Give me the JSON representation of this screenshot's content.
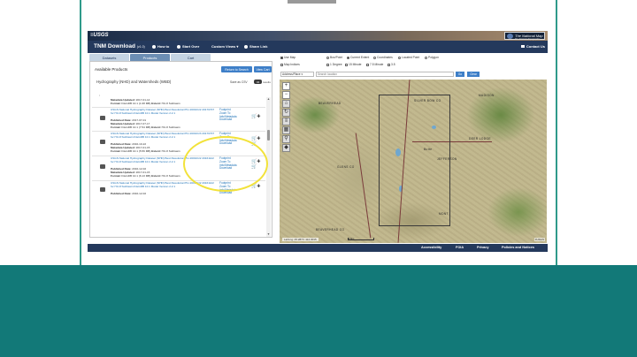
{
  "brand": {
    "usgs": "≡USGS",
    "tnm_title": "The National Map",
    "tnm_sub": "The Nation's Topographic Map"
  },
  "header": {
    "title": "TNM Download",
    "version": "(v1.0)",
    "nav": [
      "How to",
      "Start Over",
      "Custom Views ▾",
      "Share Link"
    ],
    "contact": "Contact Us"
  },
  "tabs": [
    "Datasets",
    "Products",
    "Cart"
  ],
  "products": {
    "title": "Available Products",
    "return_button": "Return to Search",
    "cart_button": "View Cart",
    "heading": "Hydrography (NHD) and Watersheds (WBD)",
    "save_csv": "Save as CSV",
    "results_count": "34",
    "results_word": "results",
    "ellipsis": ":",
    "items": [
      {
        "meta": [
          [
            "Metadata Updated:",
            "2017-01-14"
          ],
          [
            "Format:",
            "FileGDB 10.1 (1.08 MB)"
          ],
          [
            "Extent:",
            "HU-8 Subbasin"
          ]
        ],
        "title": "",
        "links": [],
        "cart": false
      },
      {
        "title": "USGS National Hydrography Dataset (NHD) Best Resolution/HU-160101/2 20170707 for HU-8 Subbasin FileGDB 10.1 Model Version 2.2.1",
        "meta": [
          [
            "Published Date:",
            "2017-07-01"
          ],
          [
            "Metadata Updated:",
            "2017-07-17"
          ],
          [
            "Format:",
            "FileGDB 10.1 (7.54 MB)"
          ],
          [
            "Extent:",
            "HU-8 Subbasin"
          ]
        ],
        "links": [
          "Footprint",
          "Zoom To",
          "Info/Metadata",
          "Download"
        ],
        "cart": true
      },
      {
        "title": "USGS National Hydrography Dataset (NHD) Best Resolution/HU-160101/3 20170707 for HU-8 Subbasin FileGDB 10.1 Model Version 2.2.1",
        "meta": [
          [
            "Published Date:",
            "2016-10-22"
          ],
          [
            "Metadata Updated:",
            "2017-01-15"
          ],
          [
            "Format:",
            "FileGDB 10.1 (5.56 MB)"
          ],
          [
            "Extent:",
            "HU-8 Subbasin"
          ]
        ],
        "links": [
          "Footprint",
          "Zoom To",
          "Info/Metadata",
          "Download"
        ],
        "cart": true
      },
      {
        "title": "USGS National Hydrography Dataset (NHD) Best Resolution/HU-160101/2 20161122 for HU-8 Subbasin FileGDB 10.1 Model Version 2.2.1",
        "meta": [
          [
            "Published Date:",
            "2016-12-02"
          ],
          [
            "Metadata Updated:",
            "2017-01-15"
          ],
          [
            "Format:",
            "FileGDB 10.1 (6.13 MB)"
          ],
          [
            "Extent:",
            "HU-8 Subbasin"
          ]
        ],
        "links": [
          "Footprint",
          "Zoom To",
          "Info/Metadata",
          "Download"
        ],
        "cart": true
      },
      {
        "title": "USGS National Hydrography Dataset (NHD) Best Resolution/HU-160101/2 20161122 for HU-8 Subbasin FileGDB 10.1 Model Version 2.2.1",
        "meta": [
          [
            "Published Date:",
            "2016-12-02"
          ]
        ],
        "links": [
          "Footprint",
          "Zoom To",
          "Info/Metadata",
          "Download"
        ],
        "cart": true
      }
    ]
  },
  "map_options": {
    "row1": [
      {
        "label": "Use Map",
        "type": "box",
        "on": true
      },
      {
        "label": "Box/Point",
        "type": "radio",
        "on": false
      },
      {
        "label": "Current Extent",
        "type": "radio",
        "on": true
      },
      {
        "label": "Coordinates",
        "type": "radio",
        "on": false
      },
      {
        "label": "Located Point",
        "type": "radio",
        "on": false
      },
      {
        "label": "Polygon",
        "type": "radio",
        "on": false
      }
    ],
    "row2": [
      {
        "label": "Map Indices",
        "type": "box",
        "on": false
      },
      {
        "label": "1 Degree",
        "type": "box",
        "on": false
      },
      {
        "label": "15 Minute",
        "type": "box",
        "on": false
      },
      {
        "label": "7.5 Minute",
        "type": "box",
        "on": false
      },
      {
        "label": "3.5",
        "type": "box",
        "on": false
      }
    ],
    "select": "Address/Place",
    "search_placeholder": "Search location",
    "go": "Go",
    "clear": "Clear"
  },
  "map": {
    "labels": [
      {
        "text": "BEAVERHEAD",
        "pos": "l1"
      },
      {
        "text": "SILVER BOW CO",
        "pos": "l2"
      },
      {
        "text": "DEER LODGE",
        "pos": "l3"
      },
      {
        "text": "MADISON",
        "pos": "l4"
      },
      {
        "text": "Butte",
        "pos": "l5"
      },
      {
        "text": "JEFFERSON",
        "pos": "l6"
      },
      {
        "text": "GLENS CO",
        "pos": "l7"
      },
      {
        "text": "BEAVERHEAD CO",
        "pos": "l8"
      },
      {
        "text": "MONT",
        "pos": "l9"
      }
    ],
    "coords": "Lat/Lng: 45.2873 -112.3015",
    "scale": "10km",
    "credit": "≡USGS"
  },
  "footer": [
    "Accessibility",
    "FOIA",
    "Privacy",
    "Policies and Notices"
  ]
}
